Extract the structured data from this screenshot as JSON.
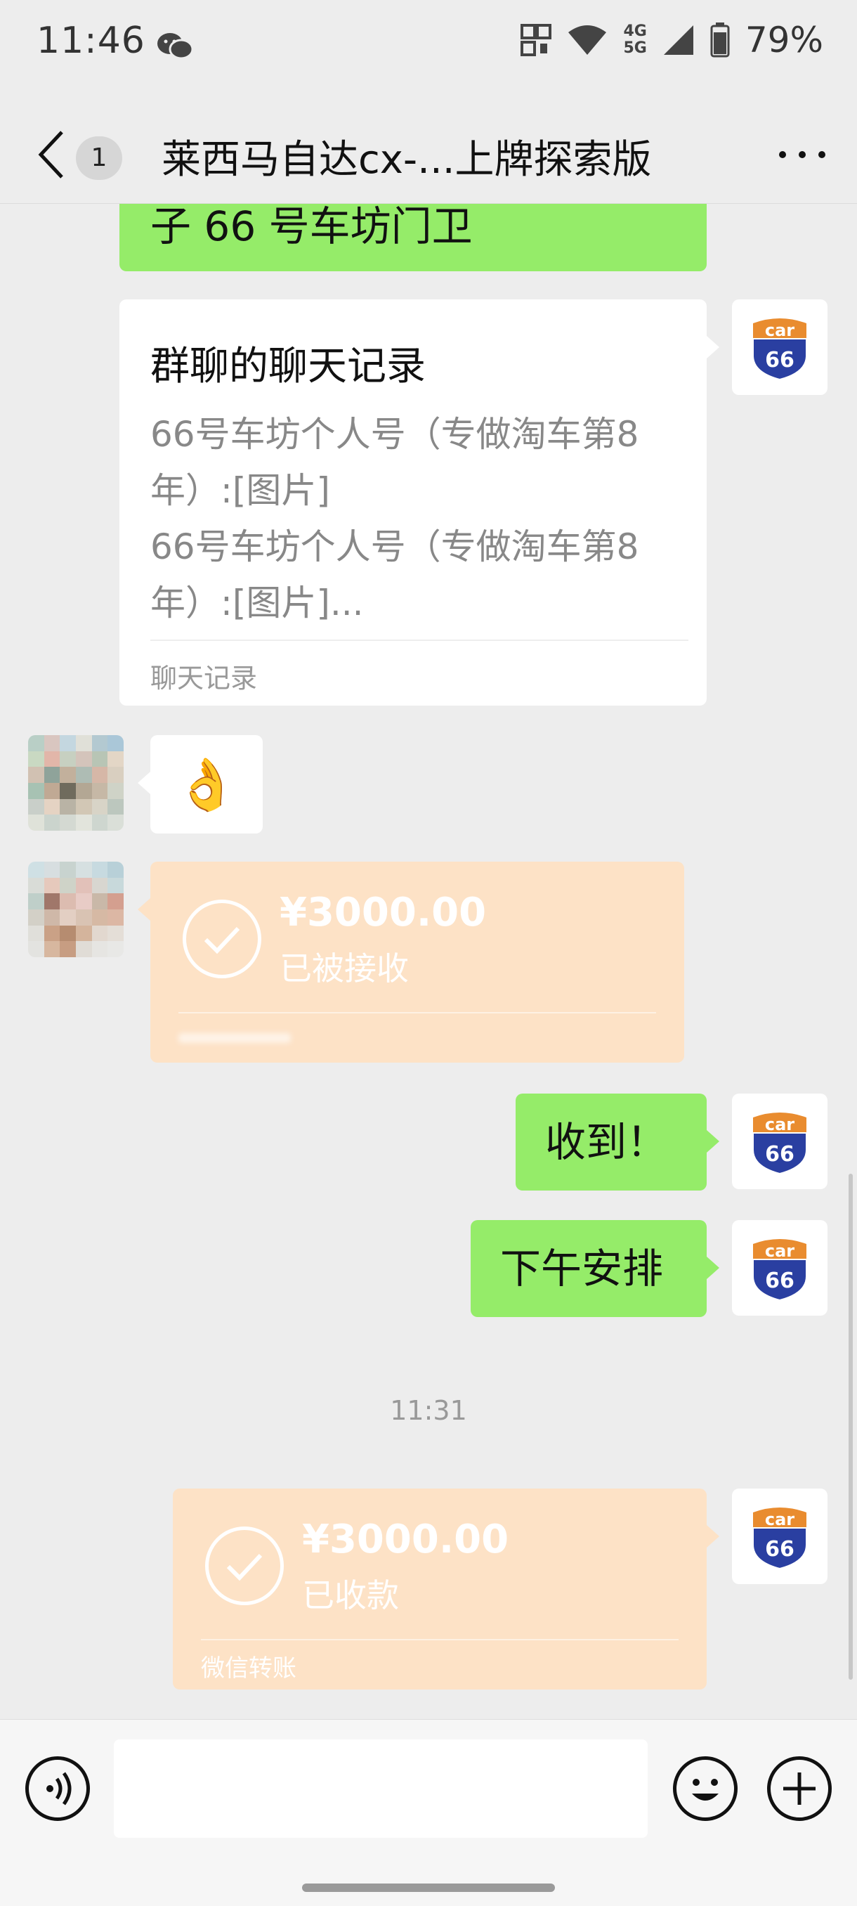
{
  "status_bar": {
    "time": "11:46",
    "network": [
      "4G",
      "5G"
    ],
    "battery": "79%"
  },
  "header": {
    "unread_count": "1",
    "title": "莱西马自达cx-...上牌探索版"
  },
  "messages": {
    "partial_bubble_text": "子 66 号车坊门卫",
    "chat_record_card": {
      "title": "群聊的聊天记录",
      "line1": "66号车坊个人号（专做淘车第8",
      "line2": "年）:[图片]",
      "line3": "66号车坊个人号（专做淘车第8",
      "line4": "年）:[图片]...",
      "footer": "聊天记录"
    },
    "emoji": "👌",
    "transfer_received_left": {
      "amount": "¥3000.00",
      "status": "已被接收"
    },
    "reply1": "收到！",
    "reply2": "下午安排",
    "timestamp": "11:31",
    "transfer_received_right": {
      "amount": "¥3000.00",
      "status": "已收款",
      "footer": "微信转账"
    }
  },
  "avatar": {
    "logo_top": "car",
    "logo_number": "66"
  },
  "input_bar": {
    "placeholder": ""
  },
  "colors": {
    "bubble_green": "#95ec69",
    "transfer_orange": "#fde2c6",
    "background": "#ededed",
    "logo_blue": "#2a3fa1",
    "logo_orange": "#e98c2f"
  }
}
